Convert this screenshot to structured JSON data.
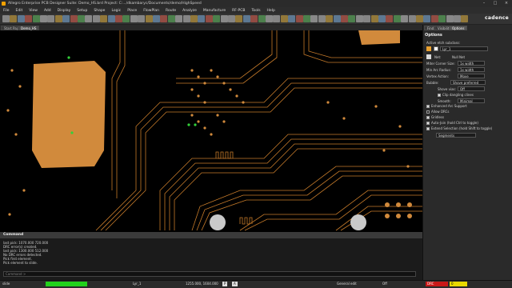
{
  "title": "Allegro Enterprise PCB Designer Suite: Demo_HS.brd  Project: C:.../dkambaryc/Documents/demo/HighSpeed",
  "menu": [
    "File",
    "Edit",
    "View",
    "Add",
    "Display",
    "Setup",
    "Shape",
    "Logic",
    "Place",
    "FlowPlan",
    "Route",
    "Analyze",
    "Manufacture",
    "RF-PCB",
    "Tools",
    "Help"
  ],
  "brand": "cadence",
  "tabs": [
    "Start Page",
    "Demo_HS"
  ],
  "right_tabs": [
    "Find",
    "Visibility",
    "Options"
  ],
  "options": {
    "title": "Options",
    "subclass_label": "Active etch subclass:",
    "subclass_value": "Lyr_1",
    "net_label": "Net:",
    "net_value": "Null Net",
    "fields": [
      {
        "label": "Miter Corner Size:",
        "value": "1x width"
      },
      {
        "label": "Min Arc Radius:",
        "value": "1x width"
      },
      {
        "label": "Vertex Action:",
        "value": "Move"
      },
      {
        "label": "Bubble:",
        "value": "Shove preferred"
      },
      {
        "label": "Shove vias:",
        "value": "Off"
      },
      {
        "label": "Smooth:",
        "value": "Minimal"
      }
    ],
    "clip_label": "Clip dangling clines",
    "checks": [
      {
        "label": "Enhanced Arc Support",
        "checked": true
      },
      {
        "label": "Allow DRCs",
        "checked": false
      },
      {
        "label": "Gridless",
        "checked": true
      },
      {
        "label": "Auto-Join (hold Ctrl to toggle)",
        "checked": true
      },
      {
        "label": "Extend Selection (hold Shift to toggle)",
        "checked": true
      }
    ],
    "segments_value": "Segments"
  },
  "command": {
    "title": "Command",
    "lines": [
      "last pick:  1070.000 720.000",
      "DRC error(s) created.",
      "last pick:  1300.000 512.000",
      "No DRC errors detected.",
      "Pick first element.",
      "Pick element to slide."
    ],
    "input_placeholder": "Command >"
  },
  "status": {
    "mode": "slide",
    "layer": "Lyr_1",
    "coords": "1255.000, 1604.000",
    "p_label": "P",
    "a_label": "A",
    "edit_mode": "General edit",
    "off": "Off",
    "drc": "DRC",
    "drc_count": "0"
  },
  "colors": {
    "board_copper": "#d18a3c",
    "trace": "#c57a2a",
    "statusbar_green": "#22d11c",
    "drc_yellow": "#e8d800"
  }
}
